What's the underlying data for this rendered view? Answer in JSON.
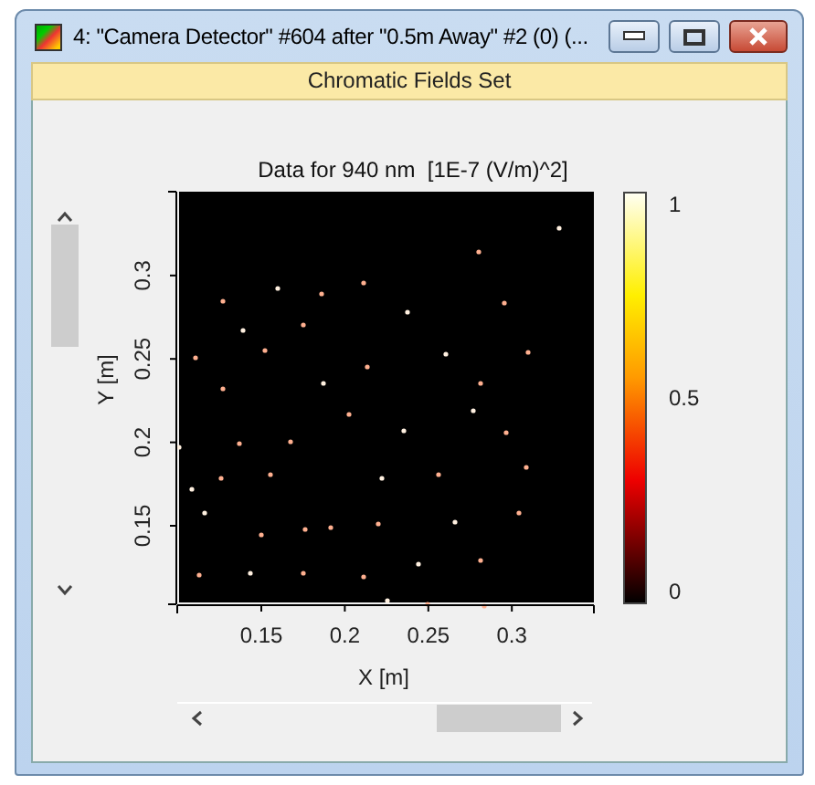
{
  "window": {
    "title": "4: \"Camera Detector\" #604 after \"0.5m Away\" #2 (0) (..."
  },
  "banner": "Chromatic Fields Set",
  "plot": {
    "title": "Data for 940 nm  [1E-7 (V/m)^2]",
    "x_axis": {
      "label": "X [m]",
      "ticks": [
        "0.15",
        "0.2",
        "0.25",
        "0.3"
      ]
    },
    "y_axis": {
      "label": "Y [m]",
      "ticks": [
        "0.15",
        "0.2",
        "0.25",
        "0.3"
      ]
    },
    "colorbar": {
      "ticks": [
        "1",
        "0.5",
        "0"
      ]
    }
  }
}
